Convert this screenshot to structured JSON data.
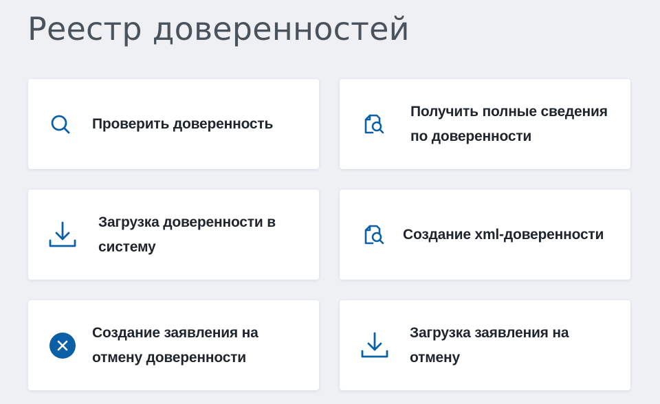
{
  "page": {
    "title": "Реестр доверенностей"
  },
  "cards": [
    {
      "label_line1": "Проверить доверенность",
      "label_line2": "",
      "icon": "search-icon"
    },
    {
      "label_line1": "Получить полные сведения",
      "label_line2": "по доверенности",
      "icon": "document-search-icon"
    },
    {
      "label_line1": "Загрузка доверенности в",
      "label_line2": "систему",
      "icon": "download-icon"
    },
    {
      "label_line1": "Создание xml-доверенности",
      "label_line2": "",
      "icon": "document-search-icon"
    },
    {
      "label_line1": "Создание заявления на",
      "label_line2": "отмену доверенности",
      "icon": "cancel-icon"
    },
    {
      "label_line1": "Загрузка заявления на",
      "label_line2": "отмену",
      "icon": "download-icon"
    }
  ],
  "colors": {
    "accent": "#0b5fa5",
    "background": "#eef0f4",
    "card": "#ffffff",
    "text": "#1f252c",
    "title": "#4a525c"
  }
}
